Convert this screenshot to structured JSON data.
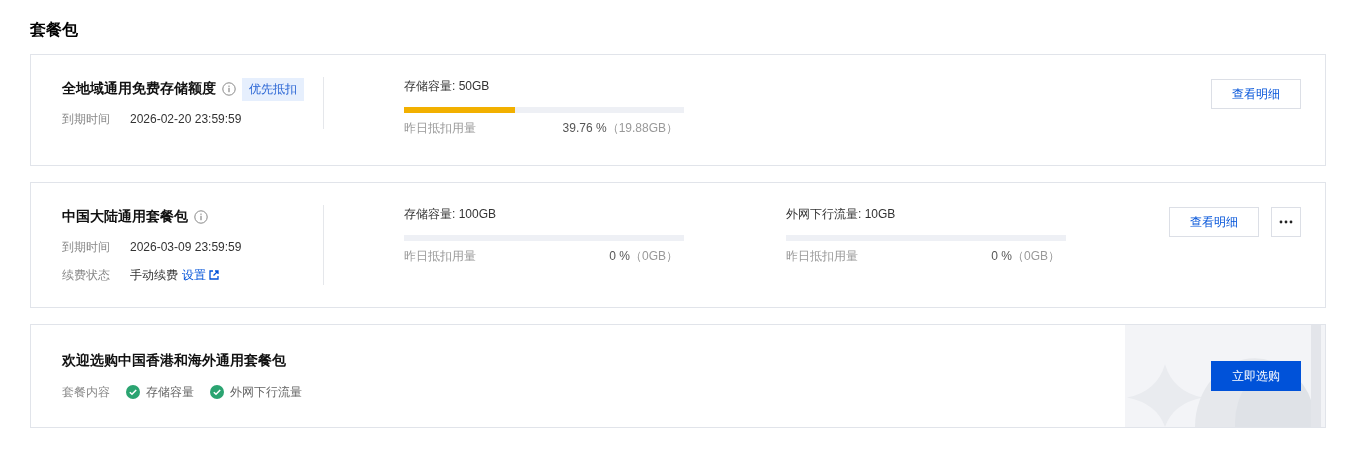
{
  "page_title": "套餐包",
  "packages": [
    {
      "title": "全地域通用免费存储额度",
      "tag": "优先抵扣",
      "fields": [
        {
          "label": "到期时间",
          "value": "2026-02-20 23:59:59"
        }
      ],
      "metrics": [
        {
          "label": "存储容量: 50GB",
          "level": 0.3976,
          "usage_label": "昨日抵扣用量",
          "percent": "39.76 %",
          "amount": "（19.88GB）"
        }
      ],
      "actions": [
        {
          "kind": "button",
          "label": "查看明细"
        }
      ]
    },
    {
      "title": "中国大陆通用套餐包",
      "fields": [
        {
          "label": "到期时间",
          "value": "2026-03-09 23:59:59"
        },
        {
          "label": "续费状态",
          "value": "手动续费",
          "link": "设置"
        }
      ],
      "metrics": [
        {
          "label": "存储容量: 100GB",
          "usage_label": "昨日抵扣用量",
          "percent": "0 %",
          "amount": "（0GB）"
        },
        {
          "label": "外网下行流量: 10GB",
          "usage_label": "昨日抵扣用量",
          "percent": "0 %",
          "amount": "（0GB）"
        }
      ],
      "actions": [
        {
          "kind": "button",
          "label": "查看明细"
        },
        {
          "kind": "more"
        }
      ]
    }
  ],
  "promo": {
    "title": "欢迎选购中国香港和海外通用套餐包",
    "content_label": "套餐内容",
    "features": [
      "存储容量",
      "外网下行流量"
    ],
    "button": "立即选购"
  }
}
